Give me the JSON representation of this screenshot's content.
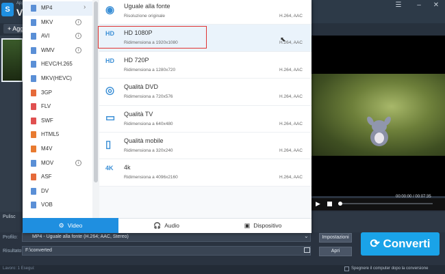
{
  "app": {
    "name_small": "App",
    "name_big": "Vi",
    "add_label": "+ Agg"
  },
  "formats": [
    {
      "label": "MP4",
      "color": "#5a8fd6",
      "info": false,
      "arrow": true,
      "selected": true
    },
    {
      "label": "MKV",
      "color": "#5a8fd6",
      "info": true
    },
    {
      "label": "AVI",
      "color": "#5a8fd6",
      "info": true
    },
    {
      "label": "WMV",
      "color": "#5a8fd6",
      "info": true
    },
    {
      "label": "HEVC/H.265",
      "color": "#5a8fd6",
      "info": false
    },
    {
      "label": "MKV(HEVC)",
      "color": "#5a8fd6",
      "info": false
    },
    {
      "label": "3GP",
      "color": "#e56a3a",
      "info": false
    },
    {
      "label": "FLV",
      "color": "#e05050",
      "info": false
    },
    {
      "label": "SWF",
      "color": "#e05050",
      "info": false
    },
    {
      "label": "HTML5",
      "color": "#e87a30",
      "info": false
    },
    {
      "label": "M4V",
      "color": "#e87a30",
      "info": false
    },
    {
      "label": "MOV",
      "color": "#5a8fd6",
      "info": true
    },
    {
      "label": "ASF",
      "color": "#e56a3a",
      "info": false
    },
    {
      "label": "DV",
      "color": "#5a8fd6",
      "info": false
    },
    {
      "label": "VOB",
      "color": "#5a8fd6",
      "info": false
    }
  ],
  "presets": [
    {
      "name": "Uguale alla fonte",
      "res": "Risoluzione originale",
      "codec": "H.264, AAC",
      "icon": "same-as-source-icon"
    },
    {
      "name": "HD 1080P",
      "res": "Ridimensiona a 1920x1080",
      "codec": "H.264, AAC",
      "icon": "hd-1080p-icon"
    },
    {
      "name": "HD 720P",
      "res": "Ridimensiona a 1280x720",
      "codec": "H.264, AAC",
      "icon": "hd-720p-icon"
    },
    {
      "name": "Qualità DVD",
      "res": "Ridimensiona a 720x576",
      "codec": "H.264, AAC",
      "icon": "dvd-icon"
    },
    {
      "name": "Qualità TV",
      "res": "Ridimensiona a 640x480",
      "codec": "H.264, AAC",
      "icon": "tv-icon"
    },
    {
      "name": "Qualità mobile",
      "res": "Ridimensiona a 320x240",
      "codec": "H.264, AAC",
      "icon": "mobile-icon"
    },
    {
      "name": "4k",
      "res": "Ridimensiona a 4096x2160",
      "codec": "H.264, AAC",
      "icon": "4k-icon"
    }
  ],
  "tabs": {
    "video": "Video",
    "audio": "Audio",
    "device": "Dispositivo"
  },
  "player": {
    "time": "00:00:00 / 00:07:35"
  },
  "bottom": {
    "clean_label": "Pulisc",
    "profile_label": "Profilo:",
    "profile_value": "MP4 - Uguale alla fonte (H.264; AAC, Stereo)",
    "result_label": "Risultato:",
    "result_value": "F:\\converted",
    "settings_label": "Impostazioni",
    "open_label": "Apri",
    "convert_label": "Converti",
    "status_left": "Lavoro: 1     Esegui:",
    "shutdown_label": "Spegnere il computer dopo la conversione"
  },
  "colors": {
    "accent": "#1f8fe0",
    "convert": "#1aa3e8",
    "highlight": "#e03030"
  }
}
